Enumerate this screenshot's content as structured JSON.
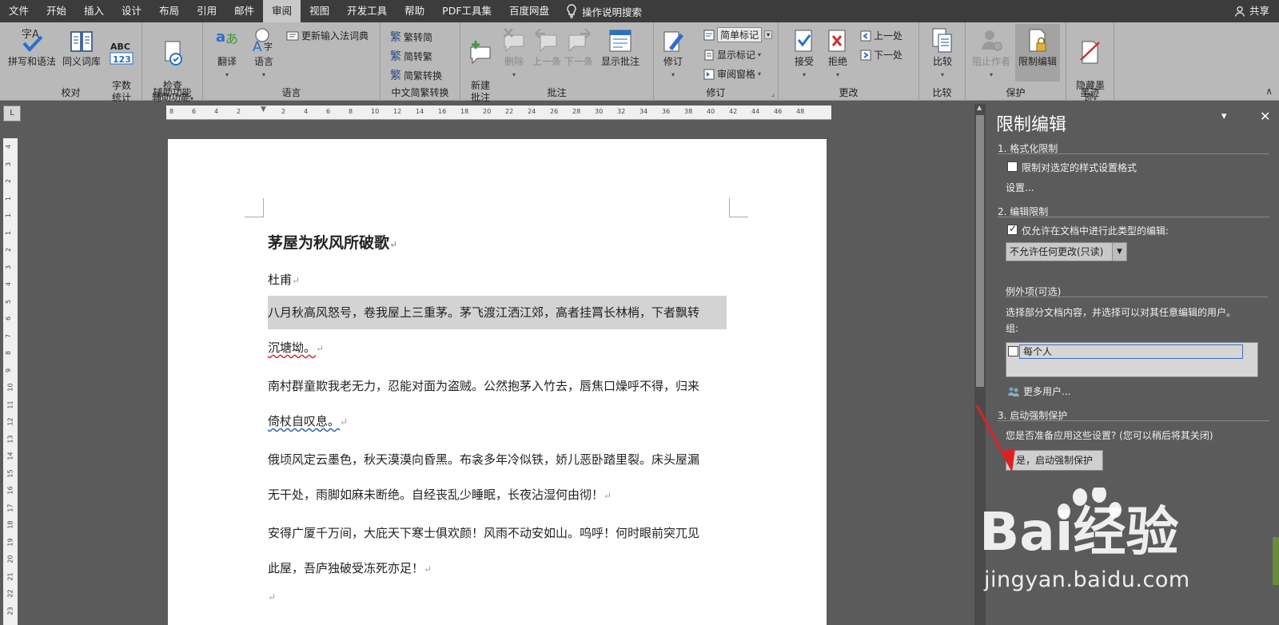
{
  "menu": {
    "tabs": [
      "文件",
      "开始",
      "插入",
      "设计",
      "布局",
      "引用",
      "邮件",
      "审阅",
      "视图",
      "开发工具",
      "帮助",
      "PDF工具集",
      "百度网盘"
    ],
    "active_tab": "审阅",
    "search_label": "操作说明搜索",
    "share_label": "共享"
  },
  "ribbon": {
    "proofing": {
      "spell_label": "拼写和语法",
      "thesaurus_label": "同义词库",
      "wordcount_label": "字数\n统计",
      "wordcount_icon_text": "ABC 123",
      "spell_icon_text": "字A",
      "group_label": "校对"
    },
    "accessibility": {
      "check_label": "检查\n辅助功能",
      "group_label": "辅助功能"
    },
    "language": {
      "translate_label": "翻译",
      "language_label": "语言",
      "update_ime_label": "更新输入法词典",
      "group_label": "语言"
    },
    "chinese": {
      "to_simplified_label": "繁转简",
      "to_traditional_label": "简转繁",
      "convert_label": "简繁转换",
      "group_label": "中文简繁转换"
    },
    "comments": {
      "new_label": "新建\n批注",
      "delete_label": "删除",
      "prev_label": "上一条",
      "next_label": "下一条",
      "show_label": "显示批注",
      "group_label": "批注"
    },
    "tracking": {
      "track_label": "修订",
      "markup_value": "简单标记",
      "show_markup_label": "显示标记",
      "review_pane_label": "审阅窗格",
      "group_label": "修订"
    },
    "changes": {
      "accept_label": "接受",
      "reject_label": "拒绝",
      "prev_label": "上一处",
      "next_label": "下一处",
      "group_label": "更改"
    },
    "compare": {
      "compare_label": "比较",
      "group_label": "比较"
    },
    "protect": {
      "block_authors_label": "阻止作者",
      "restrict_label": "限制编辑",
      "group_label": "保护"
    },
    "ink": {
      "hide_ink_label": "隐藏墨\n迹",
      "group_label": "墨迹"
    }
  },
  "ruler": {
    "corner_label": "L",
    "h_ticks": [
      "8",
      "6",
      "4",
      "2",
      "2",
      "4",
      "6",
      "8",
      "10",
      "12",
      "14",
      "16",
      "18",
      "20",
      "22",
      "24",
      "26",
      "28",
      "30",
      "32",
      "34",
      "36",
      "38",
      "40",
      "42",
      "44",
      "46",
      "48"
    ],
    "v_ticks": [
      "4",
      "3",
      "2",
      "1",
      "1",
      "1",
      "2",
      "3",
      "4",
      "5",
      "6",
      "7",
      "8",
      "9",
      "10",
      "11",
      "12",
      "13",
      "14",
      "15",
      "16",
      "17",
      "18",
      "19",
      "20",
      "21",
      "22",
      "23"
    ]
  },
  "document": {
    "title": "茅屋为秋风所破歌",
    "author": "杜甫",
    "paragraphs": [
      [
        "八月秋高风怒号，卷我屋上三重茅。茅飞渡江洒江郊，高者挂罥长林梢，下者飘转",
        "沉塘坳。"
      ],
      [
        "南村群童欺我老无力，忍能对面为盗贼。公然抱茅入竹去，唇焦口燥呼不得，归来",
        "倚杖自叹息。"
      ],
      [
        "俄顷风定云墨色，秋天漠漠向昏黑。布衾多年冷似铁，娇儿恶卧踏里裂。床头屋漏",
        "无干处，雨脚如麻未断绝。自经丧乱少睡眠，长夜沾湿何由彻！"
      ],
      [
        "安得广厦千万间，大庇天下寒士俱欢颜！风雨不动安如山。呜呼！何时眼前突兀见",
        "此屋，吾庐独破受冻死亦足！"
      ]
    ],
    "paragraph_mark": "↵"
  },
  "panel": {
    "title": "限制编辑",
    "section1": "1. 格式化限制",
    "format_restrict_label": "限制对选定的样式设置格式",
    "format_restrict_checked": false,
    "settings_link": "设置...",
    "section2": "2. 编辑限制",
    "edit_restrict_label": "仅允许在文档中进行此类型的编辑:",
    "edit_restrict_checked": true,
    "edit_type_value": "不允许任何更改(只读)",
    "exceptions_label": "例外项(可选)",
    "exceptions_desc": "选择部分文档内容，并选择可以对其任意编辑的用户。",
    "groups_label": "组:",
    "group_everyone": "每个人",
    "more_users_label": "更多用户...",
    "section3": "3. 启动强制保护",
    "enforce_question": "您是否准备应用这些设置? (您可以稍后将其关闭)",
    "start_button_label": "是，启动强制保护"
  },
  "watermark": {
    "brand": "Bai经验",
    "url": "jingyan.baidu.com"
  },
  "colors": {
    "menubar": "#3c3c3c",
    "ribbon": "#b9b9b9",
    "workspace": "#5b5b5b",
    "accent_arrow": "#e02020"
  }
}
